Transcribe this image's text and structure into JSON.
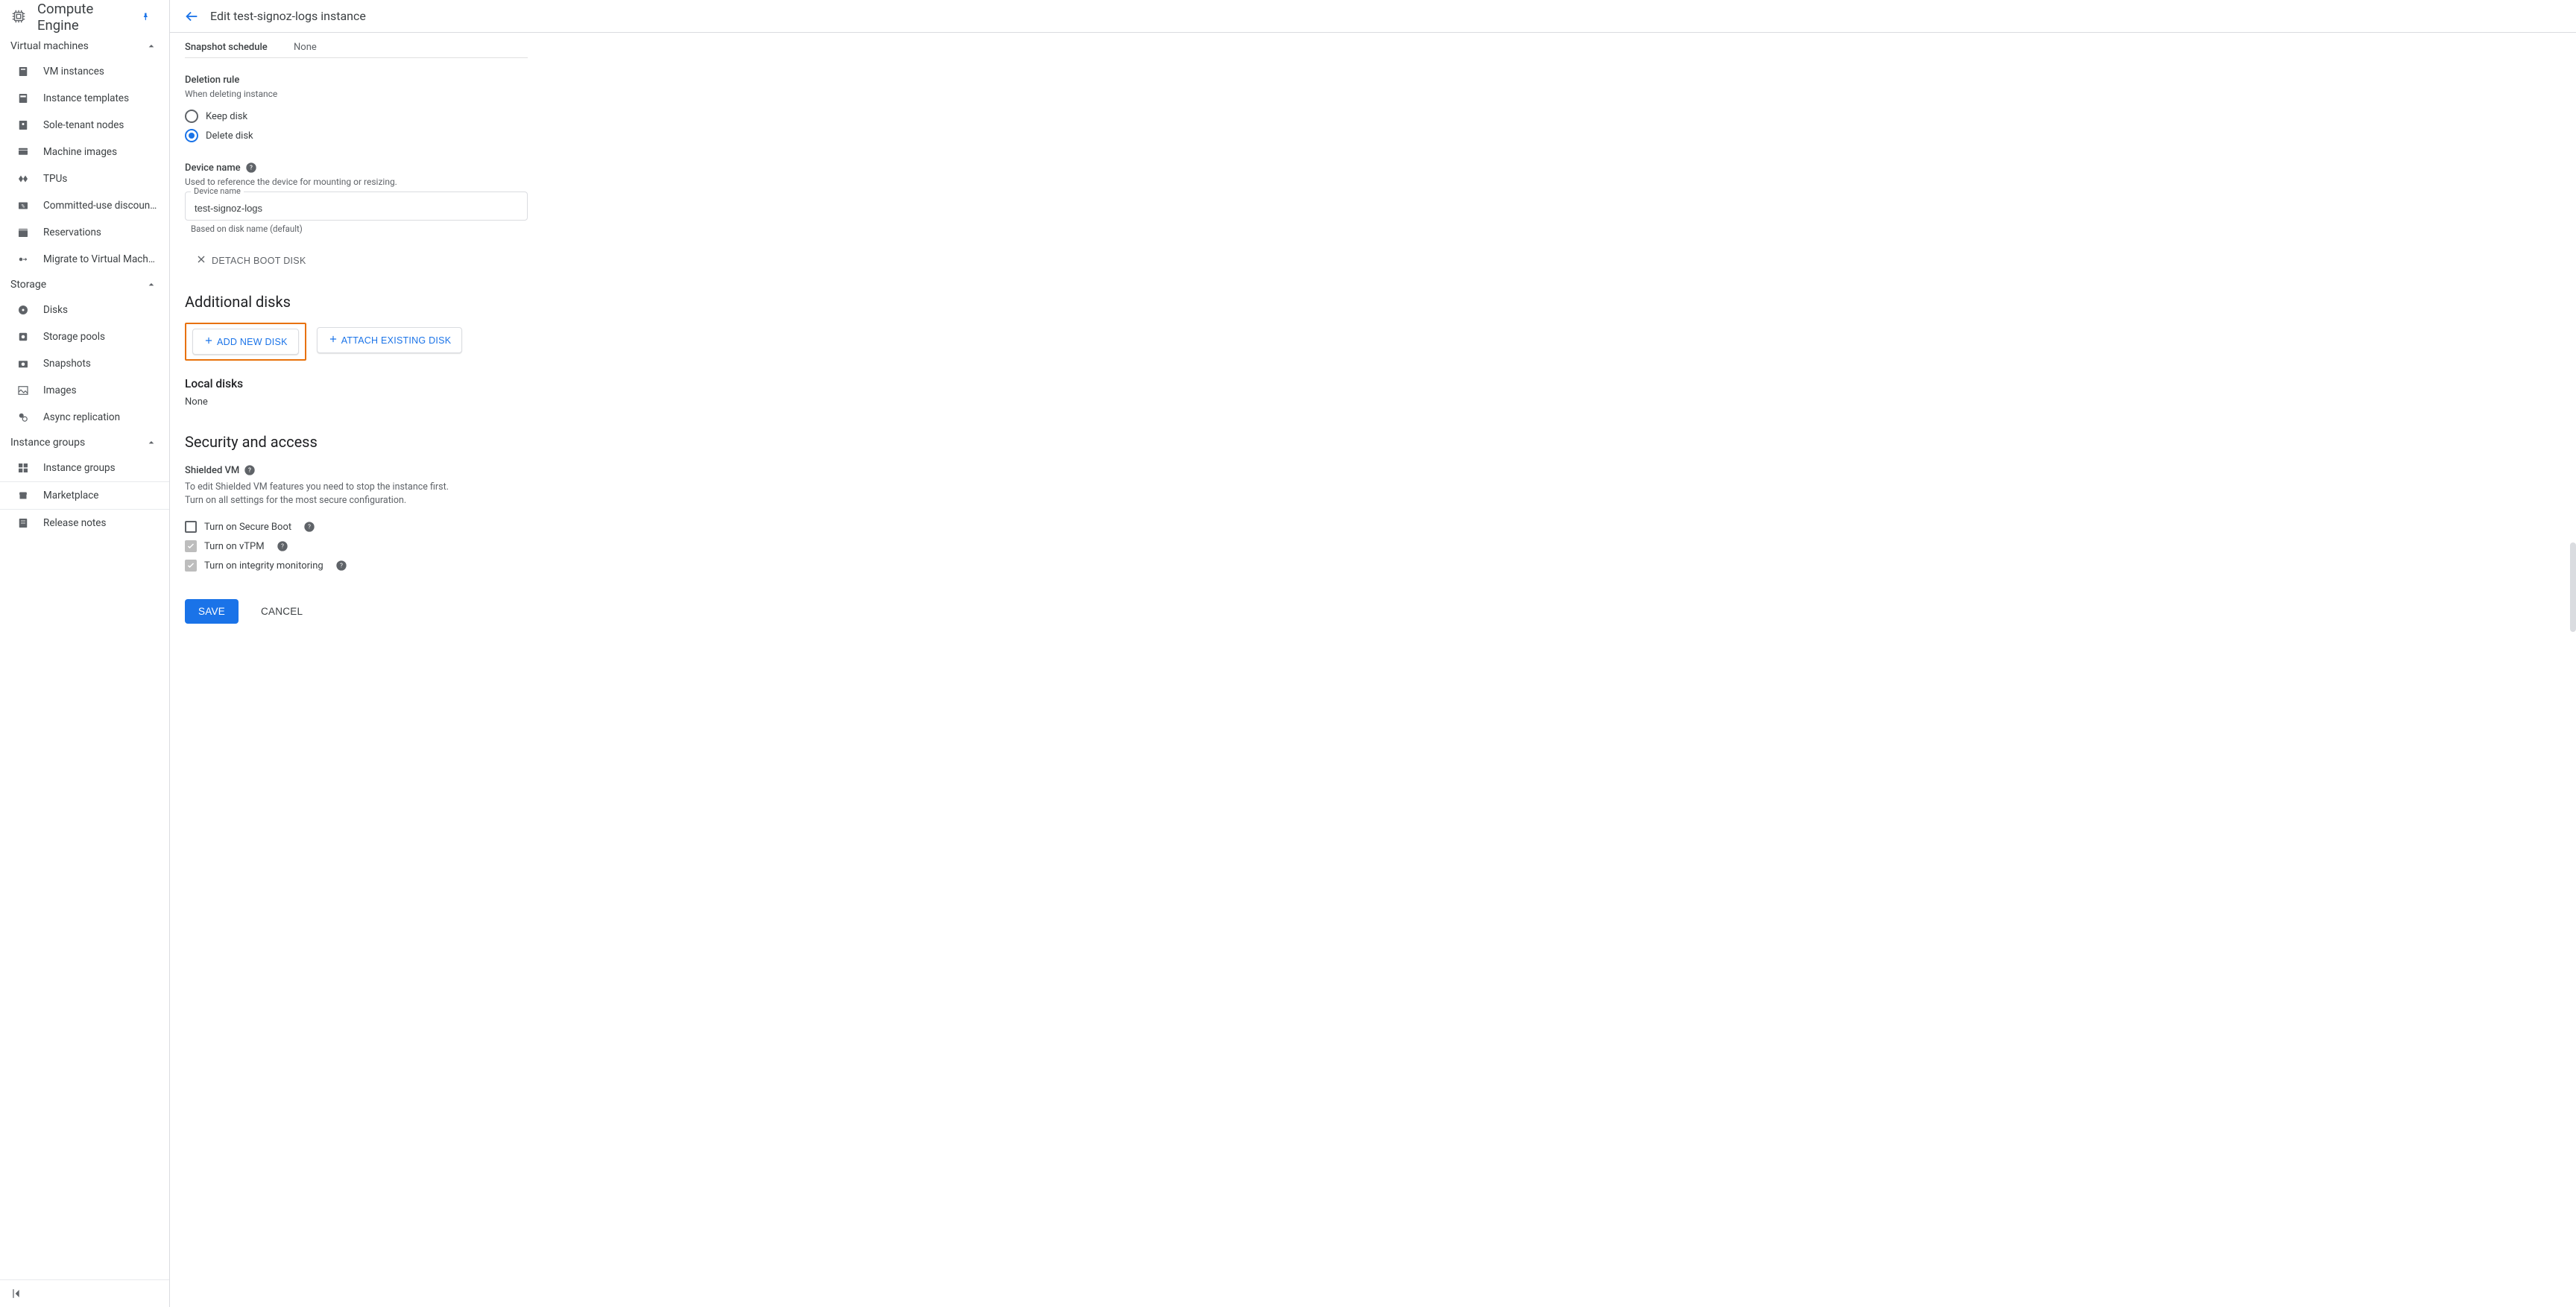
{
  "product": {
    "title": "Compute Engine"
  },
  "header": {
    "page_title": "Edit test-signoz-logs instance"
  },
  "sidebar": {
    "sections": [
      {
        "label": "Virtual machines",
        "items": [
          {
            "label": "VM instances"
          },
          {
            "label": "Instance templates"
          },
          {
            "label": "Sole-tenant nodes"
          },
          {
            "label": "Machine images"
          },
          {
            "label": "TPUs"
          },
          {
            "label": "Committed-use discounts"
          },
          {
            "label": "Reservations"
          },
          {
            "label": "Migrate to Virtual Machin…"
          }
        ]
      },
      {
        "label": "Storage",
        "items": [
          {
            "label": "Disks"
          },
          {
            "label": "Storage pools"
          },
          {
            "label": "Snapshots"
          },
          {
            "label": "Images"
          },
          {
            "label": "Async replication"
          }
        ]
      },
      {
        "label": "Instance groups",
        "items": [
          {
            "label": "Instance groups"
          }
        ]
      }
    ],
    "footer": [
      {
        "label": "Marketplace"
      },
      {
        "label": "Release notes"
      }
    ]
  },
  "snapshot": {
    "label": "Snapshot schedule",
    "value": "None"
  },
  "deletion_rule": {
    "heading": "Deletion rule",
    "sub": "When deleting instance",
    "options": {
      "keep": "Keep disk",
      "delete": "Delete disk"
    },
    "selected": "delete"
  },
  "device_name": {
    "heading": "Device name",
    "sub": "Used to reference the device for mounting or resizing.",
    "input_label": "Device name",
    "value": "test-signoz-logs",
    "helper": "Based on disk name (default)"
  },
  "buttons": {
    "detach_boot": "DETACH BOOT DISK",
    "add_disk": "ADD NEW DISK",
    "attach_disk": "ATTACH EXISTING DISK",
    "save": "SAVE",
    "cancel": "CANCEL"
  },
  "sections": {
    "additional_disks": "Additional disks",
    "local_disks": "Local disks",
    "local_disks_value": "None",
    "security": "Security and access",
    "shielded_vm": "Shielded VM",
    "shielded_desc1": "To edit Shielded VM features you need to stop the instance first.",
    "shielded_desc2": "Turn on all settings for the most secure configuration."
  },
  "shielded_options": {
    "secure_boot": "Turn on Secure Boot",
    "vtpm": "Turn on vTPM",
    "integrity": "Turn on integrity monitoring"
  }
}
